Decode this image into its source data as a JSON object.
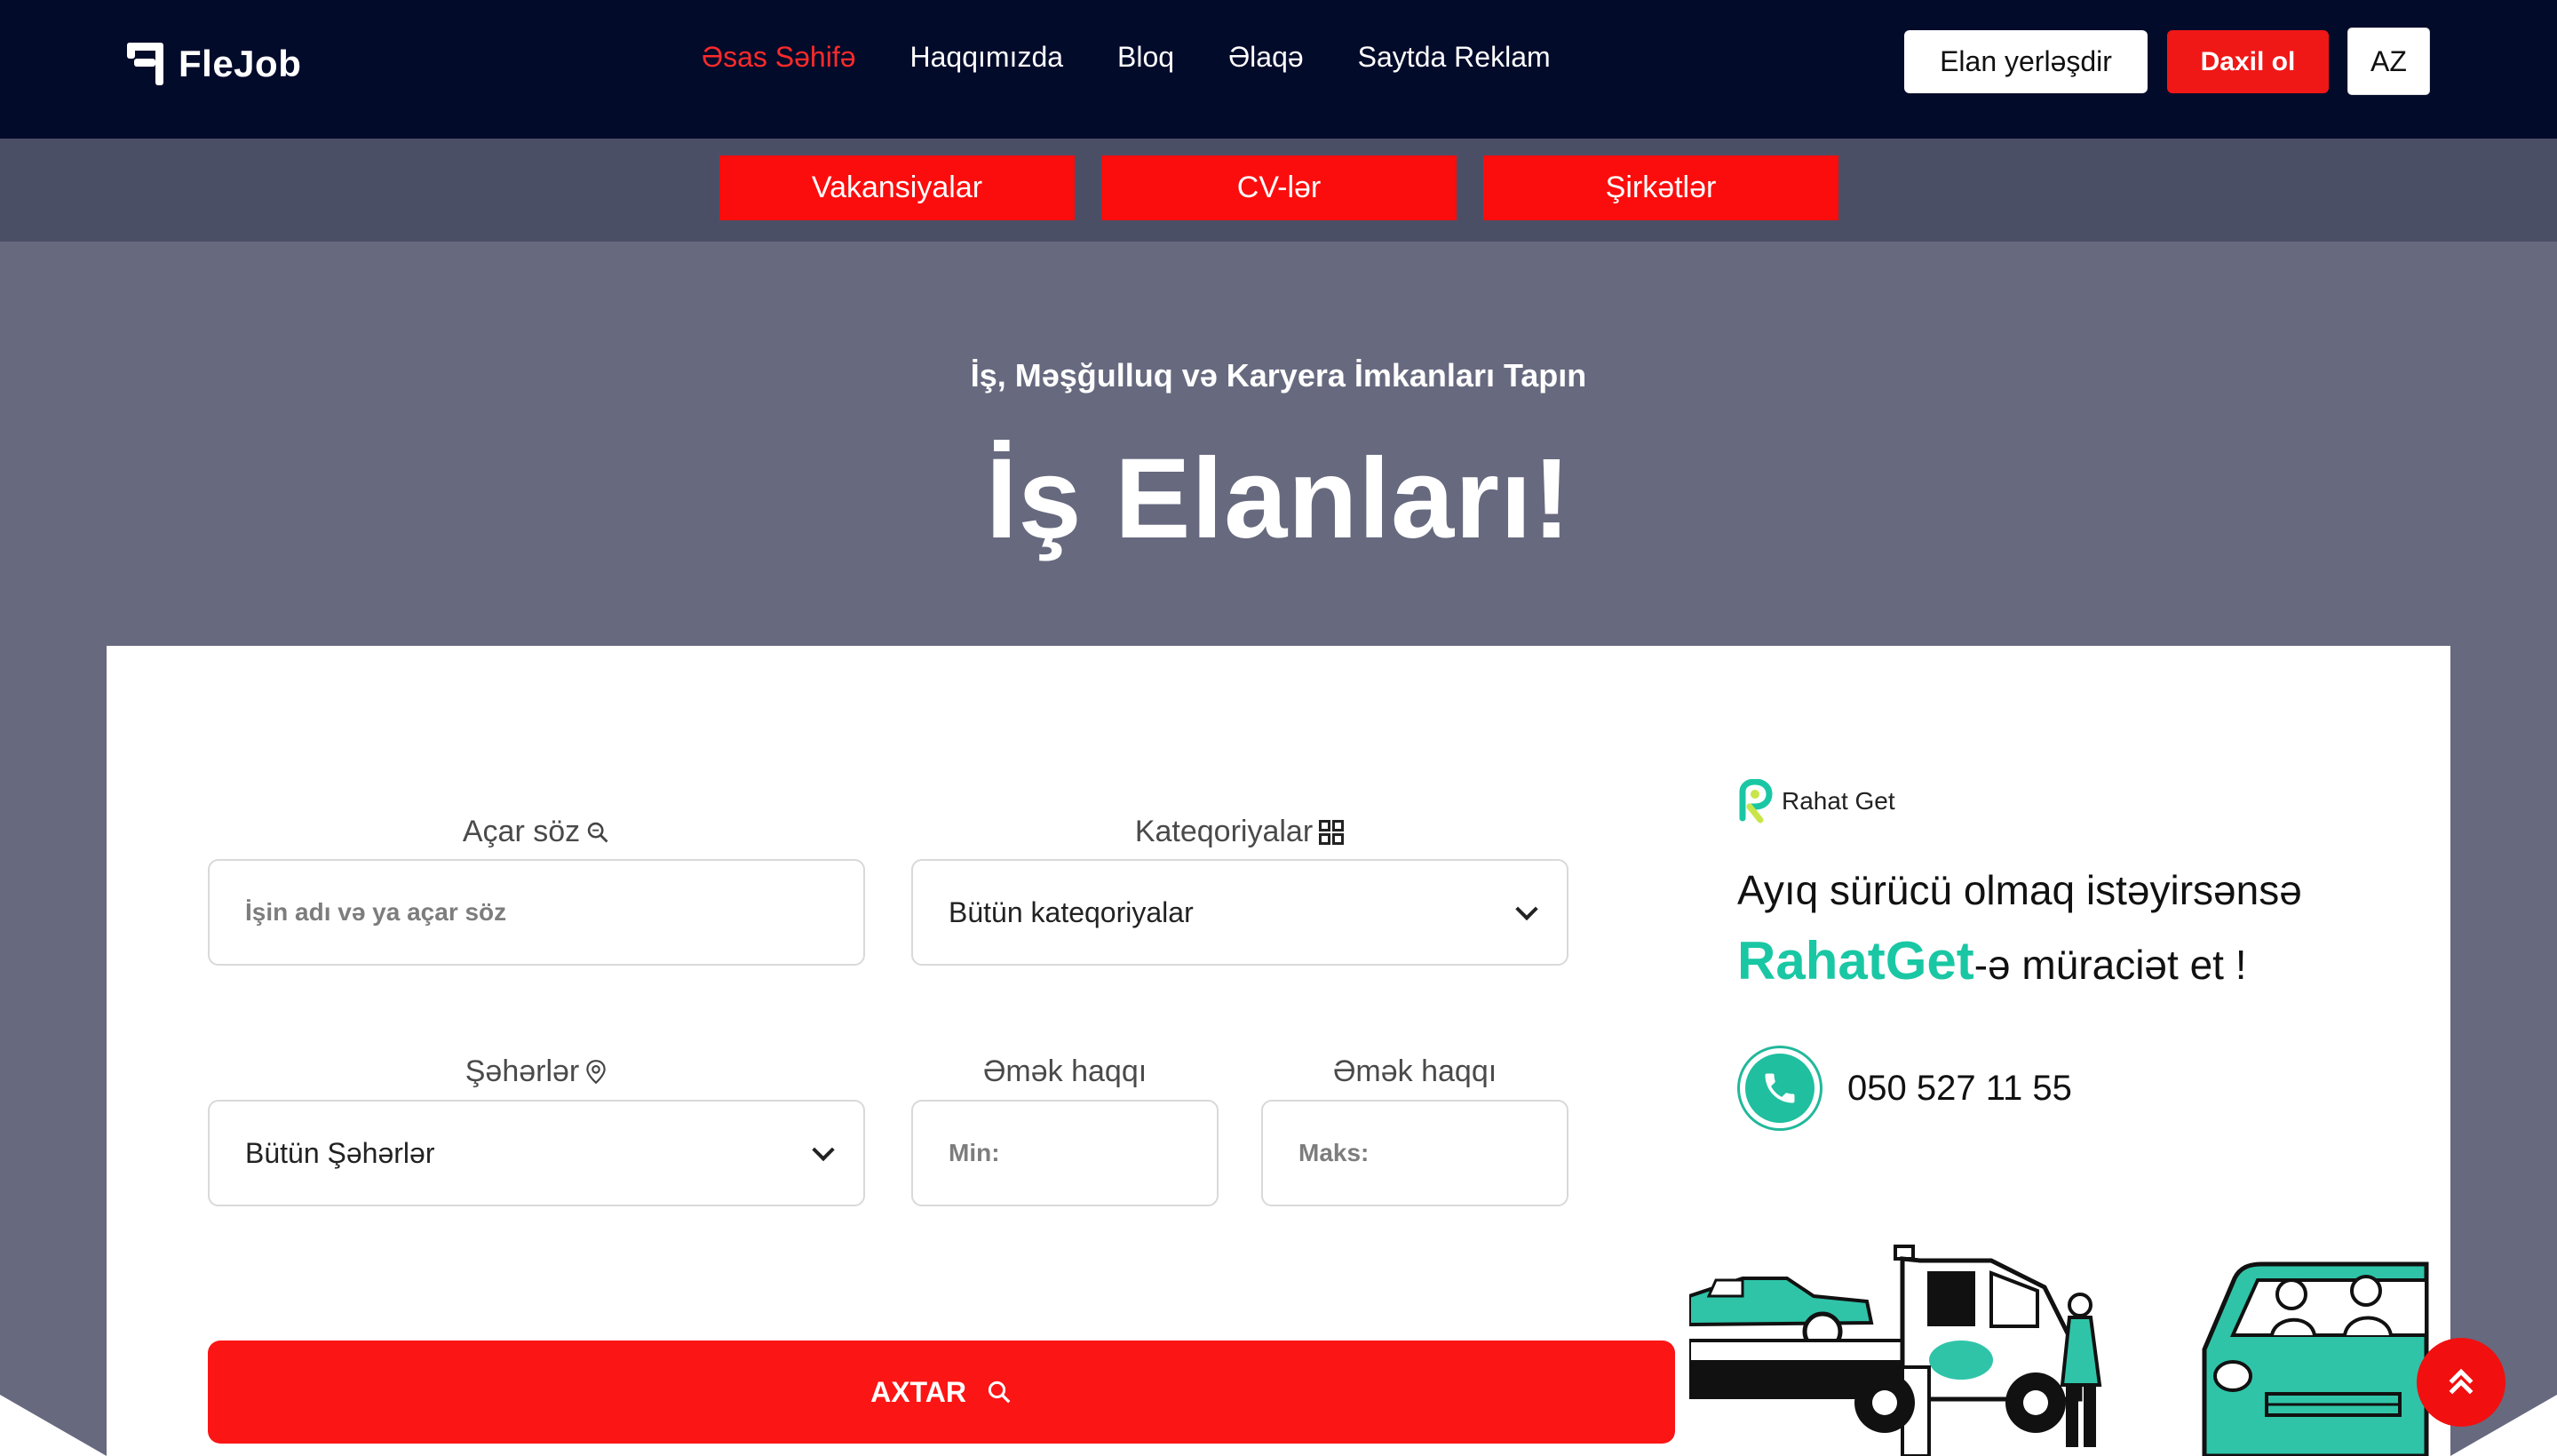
{
  "header": {
    "logo_text": "FleJob",
    "nav": [
      {
        "label": "Əsas Səhifə",
        "active": true
      },
      {
        "label": "Haqqımızda"
      },
      {
        "label": "Bloq"
      },
      {
        "label": "Əlaqə"
      },
      {
        "label": "Saytda Reklam"
      }
    ],
    "post_button": "Elan yerləşdir",
    "login_button": "Daxil ol",
    "language": "AZ"
  },
  "subnav": [
    "Vakansiyalar",
    "CV-lər",
    "Şirkətlər"
  ],
  "hero": {
    "subtitle": "İş, Məşğulluq və Karyera İmkanları Tapın",
    "title": "İş Elanları!"
  },
  "search": {
    "keyword_label": "Açar söz",
    "keyword_placeholder": "İşin adı və ya açar söz",
    "category_label": "Kateqoriyalar",
    "category_value": "Bütün kateqoriyalar",
    "city_label": "Şəhərlər",
    "city_value": "Bütün Şəhərlər",
    "salary_label_min": "Əmək haqqı",
    "salary_label_max": "Əmək haqqı",
    "salary_min_placeholder": "Min:",
    "salary_max_placeholder": "Maks:",
    "submit": "AXTAR"
  },
  "ad": {
    "brand": "Rahat Get",
    "line1": "Ayıq sürücü olmaq istəyirsənsə",
    "line2_brand": "RahatGet",
    "line2_suffix": "-ə  müraciət et !",
    "phone": "050 527 11 55"
  },
  "colors": {
    "topbar": "#030b2b",
    "accent_red": "#fc0d0d",
    "hero_bg": "#67697f",
    "teal": "#1ac7a4"
  }
}
